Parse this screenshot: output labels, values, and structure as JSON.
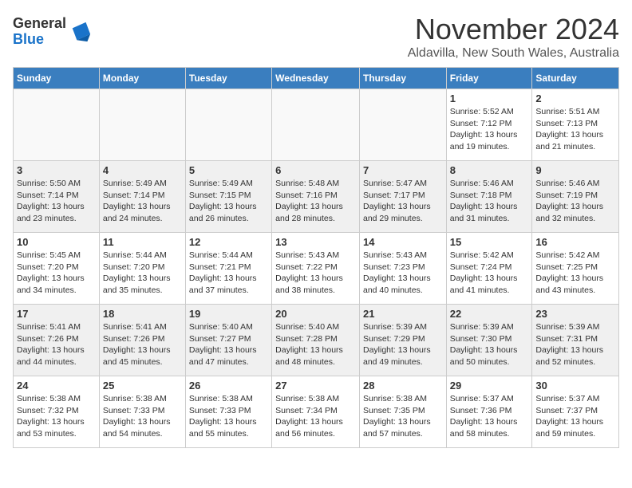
{
  "header": {
    "logo_general": "General",
    "logo_blue": "Blue",
    "month_title": "November 2024",
    "location": "Aldavilla, New South Wales, Australia"
  },
  "calendar": {
    "days_of_week": [
      "Sunday",
      "Monday",
      "Tuesday",
      "Wednesday",
      "Thursday",
      "Friday",
      "Saturday"
    ],
    "weeks": [
      [
        {
          "day": "",
          "info": ""
        },
        {
          "day": "",
          "info": ""
        },
        {
          "day": "",
          "info": ""
        },
        {
          "day": "",
          "info": ""
        },
        {
          "day": "",
          "info": ""
        },
        {
          "day": "1",
          "info": "Sunrise: 5:52 AM\nSunset: 7:12 PM\nDaylight: 13 hours\nand 19 minutes."
        },
        {
          "day": "2",
          "info": "Sunrise: 5:51 AM\nSunset: 7:13 PM\nDaylight: 13 hours\nand 21 minutes."
        }
      ],
      [
        {
          "day": "3",
          "info": "Sunrise: 5:50 AM\nSunset: 7:14 PM\nDaylight: 13 hours\nand 23 minutes."
        },
        {
          "day": "4",
          "info": "Sunrise: 5:49 AM\nSunset: 7:14 PM\nDaylight: 13 hours\nand 24 minutes."
        },
        {
          "day": "5",
          "info": "Sunrise: 5:49 AM\nSunset: 7:15 PM\nDaylight: 13 hours\nand 26 minutes."
        },
        {
          "day": "6",
          "info": "Sunrise: 5:48 AM\nSunset: 7:16 PM\nDaylight: 13 hours\nand 28 minutes."
        },
        {
          "day": "7",
          "info": "Sunrise: 5:47 AM\nSunset: 7:17 PM\nDaylight: 13 hours\nand 29 minutes."
        },
        {
          "day": "8",
          "info": "Sunrise: 5:46 AM\nSunset: 7:18 PM\nDaylight: 13 hours\nand 31 minutes."
        },
        {
          "day": "9",
          "info": "Sunrise: 5:46 AM\nSunset: 7:19 PM\nDaylight: 13 hours\nand 32 minutes."
        }
      ],
      [
        {
          "day": "10",
          "info": "Sunrise: 5:45 AM\nSunset: 7:20 PM\nDaylight: 13 hours\nand 34 minutes."
        },
        {
          "day": "11",
          "info": "Sunrise: 5:44 AM\nSunset: 7:20 PM\nDaylight: 13 hours\nand 35 minutes."
        },
        {
          "day": "12",
          "info": "Sunrise: 5:44 AM\nSunset: 7:21 PM\nDaylight: 13 hours\nand 37 minutes."
        },
        {
          "day": "13",
          "info": "Sunrise: 5:43 AM\nSunset: 7:22 PM\nDaylight: 13 hours\nand 38 minutes."
        },
        {
          "day": "14",
          "info": "Sunrise: 5:43 AM\nSunset: 7:23 PM\nDaylight: 13 hours\nand 40 minutes."
        },
        {
          "day": "15",
          "info": "Sunrise: 5:42 AM\nSunset: 7:24 PM\nDaylight: 13 hours\nand 41 minutes."
        },
        {
          "day": "16",
          "info": "Sunrise: 5:42 AM\nSunset: 7:25 PM\nDaylight: 13 hours\nand 43 minutes."
        }
      ],
      [
        {
          "day": "17",
          "info": "Sunrise: 5:41 AM\nSunset: 7:26 PM\nDaylight: 13 hours\nand 44 minutes."
        },
        {
          "day": "18",
          "info": "Sunrise: 5:41 AM\nSunset: 7:26 PM\nDaylight: 13 hours\nand 45 minutes."
        },
        {
          "day": "19",
          "info": "Sunrise: 5:40 AM\nSunset: 7:27 PM\nDaylight: 13 hours\nand 47 minutes."
        },
        {
          "day": "20",
          "info": "Sunrise: 5:40 AM\nSunset: 7:28 PM\nDaylight: 13 hours\nand 48 minutes."
        },
        {
          "day": "21",
          "info": "Sunrise: 5:39 AM\nSunset: 7:29 PM\nDaylight: 13 hours\nand 49 minutes."
        },
        {
          "day": "22",
          "info": "Sunrise: 5:39 AM\nSunset: 7:30 PM\nDaylight: 13 hours\nand 50 minutes."
        },
        {
          "day": "23",
          "info": "Sunrise: 5:39 AM\nSunset: 7:31 PM\nDaylight: 13 hours\nand 52 minutes."
        }
      ],
      [
        {
          "day": "24",
          "info": "Sunrise: 5:38 AM\nSunset: 7:32 PM\nDaylight: 13 hours\nand 53 minutes."
        },
        {
          "day": "25",
          "info": "Sunrise: 5:38 AM\nSunset: 7:33 PM\nDaylight: 13 hours\nand 54 minutes."
        },
        {
          "day": "26",
          "info": "Sunrise: 5:38 AM\nSunset: 7:33 PM\nDaylight: 13 hours\nand 55 minutes."
        },
        {
          "day": "27",
          "info": "Sunrise: 5:38 AM\nSunset: 7:34 PM\nDaylight: 13 hours\nand 56 minutes."
        },
        {
          "day": "28",
          "info": "Sunrise: 5:38 AM\nSunset: 7:35 PM\nDaylight: 13 hours\nand 57 minutes."
        },
        {
          "day": "29",
          "info": "Sunrise: 5:37 AM\nSunset: 7:36 PM\nDaylight: 13 hours\nand 58 minutes."
        },
        {
          "day": "30",
          "info": "Sunrise: 5:37 AM\nSunset: 7:37 PM\nDaylight: 13 hours\nand 59 minutes."
        }
      ]
    ]
  }
}
